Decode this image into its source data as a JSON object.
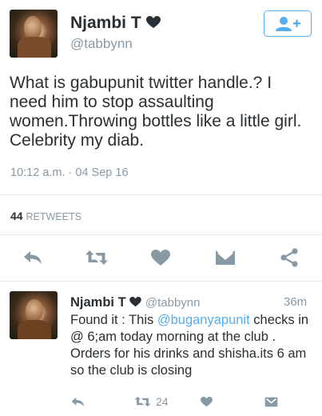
{
  "tweet": {
    "display_name": "Njambi T",
    "handle": "@tabbynn",
    "text": "What is gabupunit twitter handle.? I need him to stop assaulting women.Throwing bottles like a little girl. Celebrity my diab.",
    "timestamp": "10:12 a.m. · 04 Sep 16",
    "retweet_count": "44",
    "retweet_label": "RETWEETS",
    "actions": [
      "reply-icon",
      "retweet-icon",
      "like-icon",
      "message-icon",
      "share-icon"
    ],
    "follow_icon": "add-user-icon"
  },
  "reply": {
    "display_name": "Njambi T",
    "handle": "@tabbynn",
    "time": "36m",
    "text_before": "Found it : This ",
    "mention": "@buganyapunit",
    "text_after": " checks in @ 6;am today morning at the club . Orders for his drinks and shisha.its 6 am so the club is closing",
    "retweet_count": "24"
  },
  "colors": {
    "accent": "#55acee",
    "text": "#292f33",
    "muted": "#8899a6",
    "icon": "#8899a6",
    "heart": "#292f33"
  }
}
